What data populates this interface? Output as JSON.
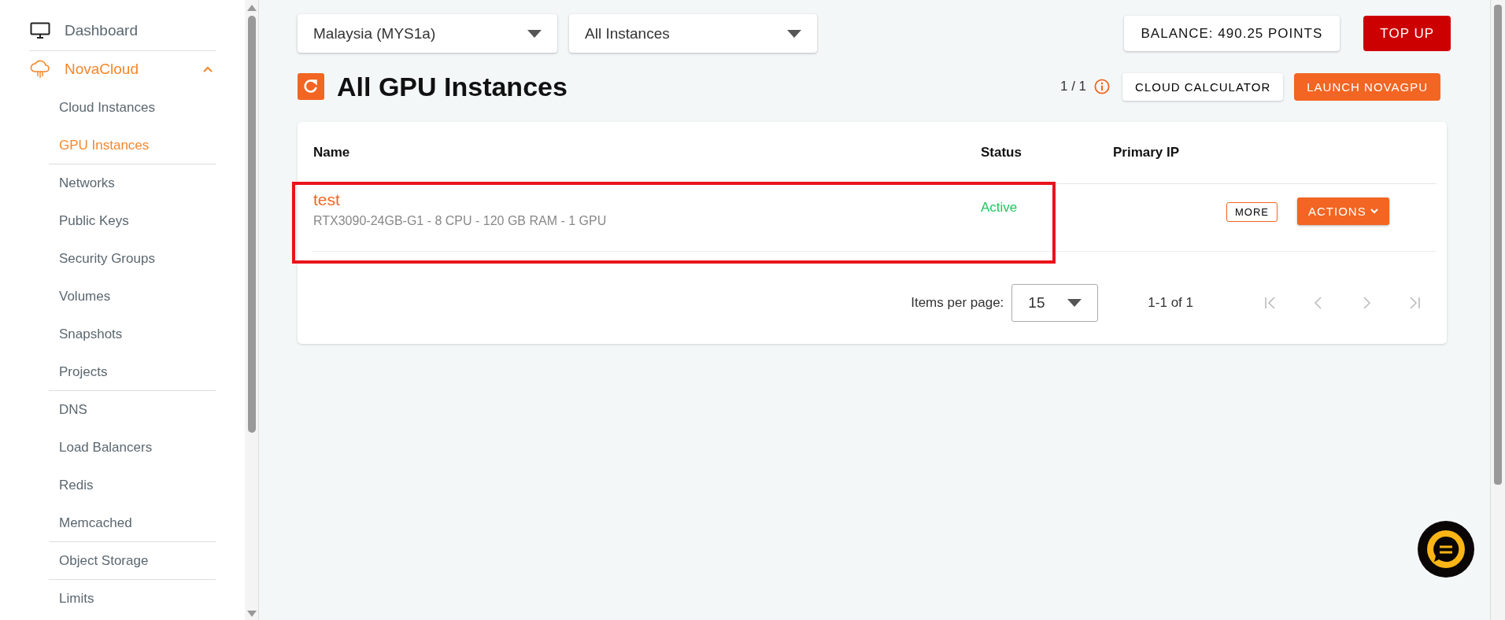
{
  "sidebar": {
    "items": [
      {
        "label": "Dashboard",
        "kind": "monitor",
        "selected": false
      },
      {
        "label": "NovaCloud",
        "kind": "cloud",
        "selected": true,
        "expanded": true,
        "children": [
          {
            "label": "Cloud Instances",
            "selected": false,
            "divider_after": false
          },
          {
            "label": "GPU Instances",
            "selected": true,
            "divider_after": true
          },
          {
            "label": "Networks",
            "selected": false,
            "divider_after": false
          },
          {
            "label": "Public Keys",
            "selected": false,
            "divider_after": false
          },
          {
            "label": "Security Groups",
            "selected": false,
            "divider_after": false
          },
          {
            "label": "Volumes",
            "selected": false,
            "divider_after": false
          },
          {
            "label": "Snapshots",
            "selected": false,
            "divider_after": false
          },
          {
            "label": "Projects",
            "selected": false,
            "divider_after": true
          },
          {
            "label": "DNS",
            "selected": false,
            "divider_after": false
          },
          {
            "label": "Load Balancers",
            "selected": false,
            "divider_after": false
          },
          {
            "label": "Redis",
            "selected": false,
            "divider_after": false
          },
          {
            "label": "Memcached",
            "selected": false,
            "divider_after": true
          },
          {
            "label": "Object Storage",
            "selected": false,
            "divider_after": true
          },
          {
            "label": "Limits",
            "selected": false,
            "divider_after": false
          }
        ]
      }
    ]
  },
  "filters": [
    {
      "value": "Malaysia (MYS1a)"
    },
    {
      "value": "All Instances"
    }
  ],
  "balance": "BALANCE: 490.25 POINTS",
  "top_up": "TOP UP",
  "title": "All GPU Instances",
  "page_count": "1 / 1",
  "calculator_button": "CLOUD CALCULATOR",
  "launch_button": "LAUNCH NOVAGPU",
  "table": {
    "columns": [
      "Name",
      "Status",
      "Primary IP"
    ],
    "rows": [
      {
        "name": "test",
        "spec": "RTX3090-24GB-G1 - 8 CPU - 120 GB RAM - 1 GPU",
        "status": "Active",
        "color": "#22c55e",
        "more": "MORE",
        "actions": "ACTIONS",
        "highlighted": true
      }
    ]
  },
  "pagination": {
    "label": "Items per page:",
    "per_page": "15",
    "range": "1-1 of 1"
  }
}
